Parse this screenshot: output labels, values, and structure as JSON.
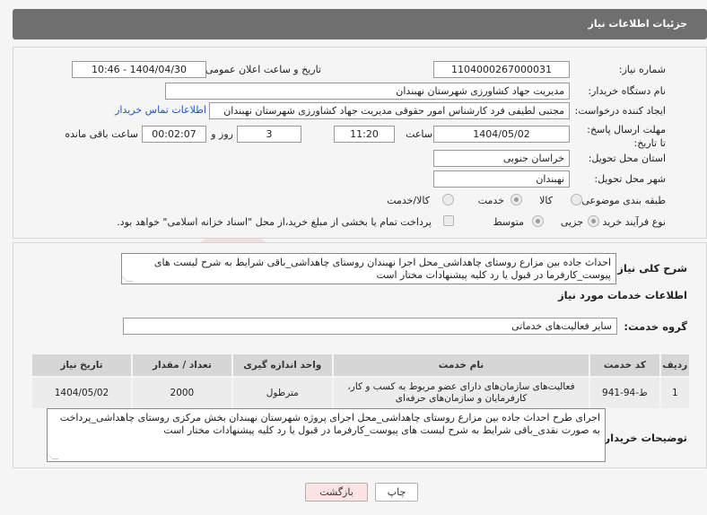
{
  "header": {
    "title": "جزئیات اطلاعات نیاز"
  },
  "fields": {
    "need_number_label": "شماره نیاز:",
    "need_number": "1104000267000031",
    "announce_label": "تاریخ و ساعت اعلان عمومی:",
    "announce_value": "1404/04/30 - 10:46",
    "buyer_org_label": "نام دستگاه خریدار:",
    "buyer_org": "مدیریت جهاد کشاورزی شهرستان نهبندان",
    "creator_label": "ایجاد کننده درخواست:",
    "creator": "مجتبی لطیفی فرد کارشناس امور حقوقی مدیریت جهاد کشاورزی شهرستان نهبندان",
    "contact_link": "اطلاعات تماس خریدار",
    "deadline_label": "مهلت ارسال پاسخ: تا تاریخ:",
    "deadline_date": "1404/05/02",
    "time_label": "ساعت",
    "deadline_time": "11:20",
    "days_value": "3",
    "days_label": "روز و",
    "remaining_time": "00:02:07",
    "remaining_label": "ساعت باقی مانده",
    "province_label": "استان محل تحویل:",
    "province": "خراسان جنوبی",
    "city_label": "شهر محل تحویل:",
    "city": "نهبندان",
    "category_label": "طبقه بندی موضوعی:",
    "category_options": [
      "کالا",
      "خدمت",
      "کالا/خدمت"
    ],
    "process_label": "نوع فرآیند خرید :",
    "process_options": [
      "جزیی",
      "متوسط"
    ],
    "payment_note": "پرداخت تمام یا بخشی از مبلغ خرید،از محل \"اسناد خزانه اسلامی\" خواهد بود."
  },
  "summary": {
    "label": "شرح کلی نیاز:",
    "text": "احداث جاده بین مزارع روستای چاهداشی_محل اجرا نهبندان روستای چاهداشی_باقی شرایط به شرح لیست های پیوست_کارفرما در قبول یا رد کلیه پیشنهادات مختار است"
  },
  "services": {
    "section_title": "اطلاعات خدمات مورد نیاز",
    "group_label": "گروه خدمت:",
    "group_value": "سایر فعالیت‌های خدماتی",
    "columns": [
      "ردیف",
      "کد خدمت",
      "نام خدمت",
      "واحد اندازه گیری",
      "تعداد / مقدار",
      "تاریخ نیاز"
    ],
    "rows": [
      [
        "1",
        "ط-94-941",
        "فعالیت‌های سازمان‌های دارای عضو مربوط به کسب و کار، کارفرمایان و سازمان‌های حرفه‌ای",
        "مترطول",
        "2000",
        "1404/05/02"
      ]
    ]
  },
  "buyer_notes": {
    "label": "توضیحات خریدار:",
    "text": "اجرای طرح احداث جاده بین مزارع روستای چاهداشی_محل اجرای پروژه شهرستان نهبندان بخش مرکزی روستای چاهداشی_پرداخت به صورت نقدی_باقی شرایط به شرح لیست های پیوست_کارفرما در قبول یا رد کلیه پیشنهادات مختار است"
  },
  "buttons": {
    "print": "چاپ",
    "back": "بازگشت"
  },
  "colors": {
    "header_bg": "#6f6f6f",
    "link": "#1a57c4",
    "back_button_bg": "#fbe3e3"
  }
}
